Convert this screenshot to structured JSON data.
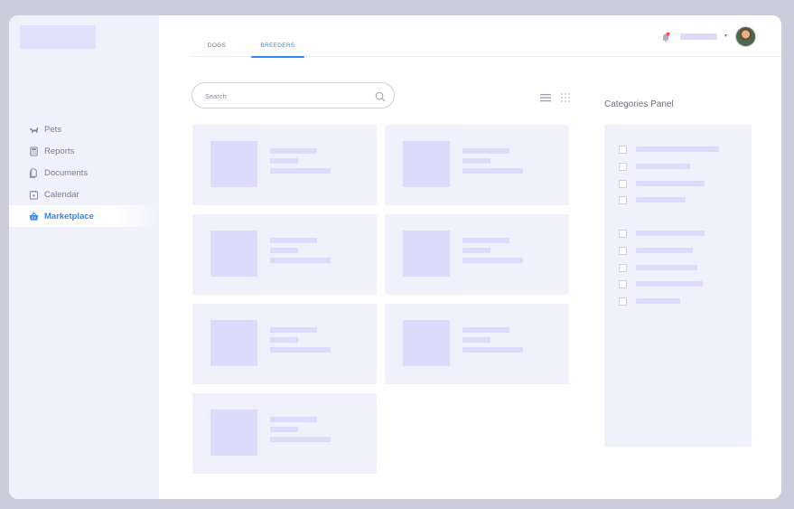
{
  "sidebar": {
    "items": [
      {
        "label": "Pets",
        "icon": "dog-icon",
        "active": false
      },
      {
        "label": "Reports",
        "icon": "calculator-icon",
        "active": false
      },
      {
        "label": "Documents",
        "icon": "documents-icon",
        "active": false
      },
      {
        "label": "Calendar",
        "icon": "calendar-icon",
        "active": false
      },
      {
        "label": "Marketplace",
        "icon": "basket-icon",
        "active": true
      }
    ]
  },
  "tabs": [
    {
      "label": "DOGS",
      "active": false
    },
    {
      "label": "BREEDERS",
      "active": true
    }
  ],
  "search": {
    "placeholder": "Search",
    "value": ""
  },
  "categories": {
    "title": "Categories Panel"
  },
  "colors": {
    "accent": "#2f86f6",
    "panel_bg": "#f1f1fd",
    "skeleton": "#dcdcfa",
    "notification_dot": "#ff4d4d"
  }
}
